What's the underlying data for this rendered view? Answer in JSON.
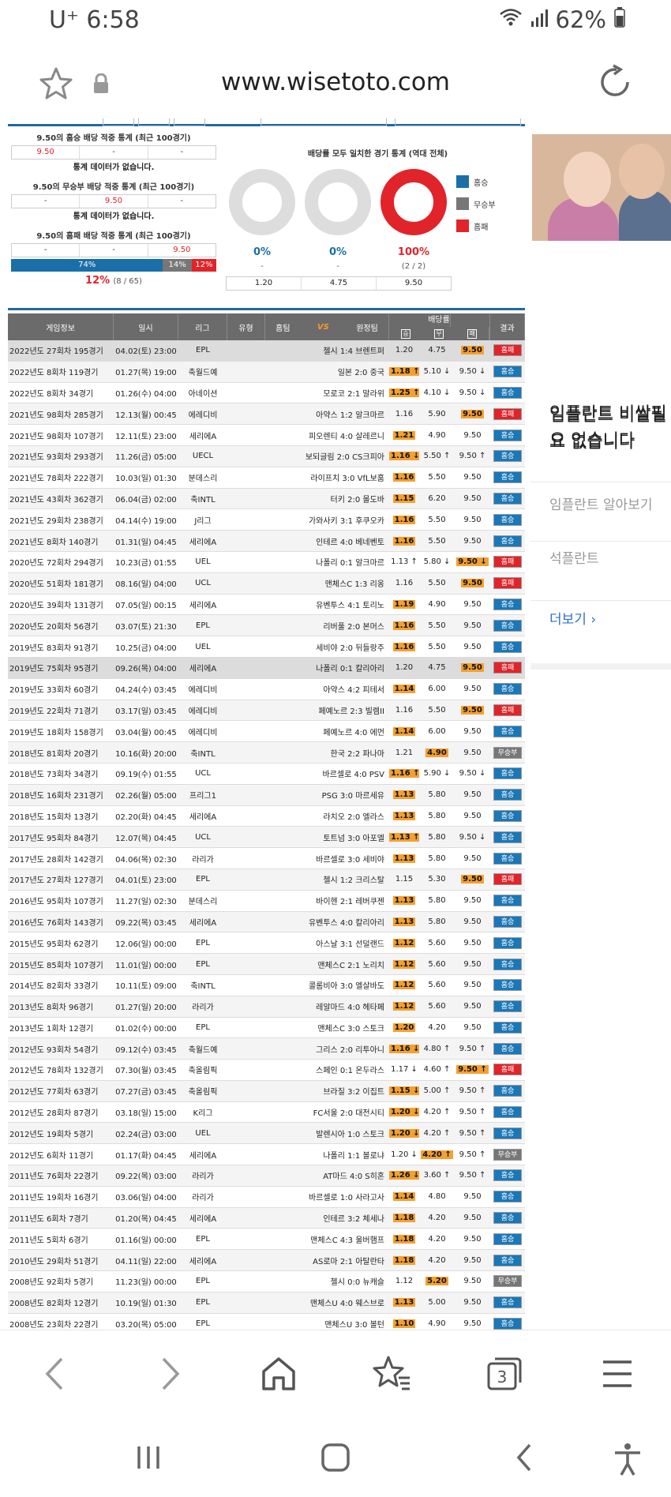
{
  "status_bar": {
    "carrier": "U⁺ 6:58",
    "battery": "62%"
  },
  "browser": {
    "url": "www.wisetoto.com",
    "tab_count": "3"
  },
  "stats": {
    "home_title": "9.50의 홈승 배당 적중 통계 (최근 100경기)",
    "home_vals": [
      "9.50",
      "-",
      "-"
    ],
    "no_data_1": "통계 데이터가 없습니다.",
    "draw_title": "9.50의 무승부 배당 적중 통계 (최근 100경기)",
    "draw_vals": [
      "-",
      "9.50",
      "-"
    ],
    "no_data_2": "통계 데이터가 없습니다.",
    "away_title": "9.50의 홈패 배당 적중 통계 (최근 100경기)",
    "away_vals": [
      "-",
      "-",
      "9.50"
    ],
    "bar": {
      "home": "74%",
      "draw": "14%",
      "away": "12%",
      "home_frac": 0.74,
      "draw_frac": 0.14,
      "away_frac": 0.12
    },
    "pct": "12%",
    "pct_detail": "(8 / 65)",
    "match_title": "배당률 모두 일치한 경기 통계 (역대 전체)",
    "donuts": [
      {
        "pct": "0%",
        "sub": "-",
        "fill": 0
      },
      {
        "pct": "0%",
        "sub": "-",
        "fill": 0
      },
      {
        "pct": "100%",
        "sub": "(2 / 2)",
        "fill": 1
      }
    ],
    "legend": [
      "홈승",
      "무승부",
      "홈패"
    ],
    "odds": [
      "1.20",
      "4.75",
      "9.50"
    ]
  },
  "colors": {
    "home": "#1a6fa8",
    "draw": "#777777",
    "away": "#e0242a",
    "highlight": "#f4a030",
    "header": "#6b6b6b"
  },
  "table": {
    "headers": {
      "info": "게임정보",
      "date": "일시",
      "league": "리그",
      "type": "유형",
      "home": "홈팀",
      "vs": "VS",
      "away": "원정팀",
      "odds": "배당률",
      "win": "승",
      "draw": "무",
      "lose": "패",
      "result": "결과"
    },
    "rows": [
      [
        "2022년도 27회차 195경기",
        "04.02(토) 23:00",
        "EPL",
        "",
        "첼시 1:4 브렌트퍼",
        "1.20",
        "4.75",
        "9.50",
        "L",
        "홈패",
        "hl"
      ],
      [
        "2022년도 8회차 119경기",
        "01.27(목) 19:00",
        "축월드예",
        "",
        "일본 2:0 중국",
        "1.18 ↑",
        "5.10 ↓",
        "9.50 ↓",
        "W",
        "홈승",
        ""
      ],
      [
        "2022년도 8회차 34경기",
        "01.26(수) 04:00",
        "아네이션",
        "",
        "모로코 2:1 말라위",
        "1.25 ↑",
        "4.10 ↓",
        "9.50 ↓",
        "W",
        "홈승",
        ""
      ],
      [
        "2021년도 98회차 285경기",
        "12.13(월) 00:45",
        "에레디비",
        "",
        "아약스 1:2 알크마르",
        "1.16",
        "5.90",
        "9.50",
        "L",
        "홈패",
        ""
      ],
      [
        "2021년도 98회차 107경기",
        "12.11(토) 23:00",
        "세리에A",
        "",
        "피오렌티 4:0 살레르니",
        "1.21",
        "4.90",
        "9.50",
        "W",
        "홈승",
        ""
      ],
      [
        "2021년도 93회차 293경기",
        "11.26(금) 05:00",
        "UECL",
        "",
        "보되글림 2:0 CS크피아",
        "1.16 ↓",
        "5.50 ↑",
        "9.50 ↑",
        "W",
        "홈승",
        ""
      ],
      [
        "2021년도 78회차 222경기",
        "10.03(일) 01:30",
        "분데스리",
        "",
        "라이프치 3:0 VfL보훔",
        "1.16",
        "5.50",
        "9.50",
        "W",
        "홈승",
        ""
      ],
      [
        "2021년도 43회차 362경기",
        "06.04(금) 02:00",
        "축INTL",
        "",
        "터키 2:0 몰도바",
        "1.15",
        "6.20",
        "9.50",
        "W",
        "홈승",
        ""
      ],
      [
        "2021년도 29회차 238경기",
        "04.14(수) 19:00",
        "J리그",
        "",
        "가와사키 3:1 후쿠오카",
        "1.16",
        "5.50",
        "9.50",
        "W",
        "홈승",
        ""
      ],
      [
        "2021년도 8회차 140경기",
        "01.31(일) 04:45",
        "세리에A",
        "",
        "인테르 4:0 베네벤토",
        "1.16",
        "5.50",
        "9.50",
        "W",
        "홈승",
        ""
      ],
      [
        "2020년도 72회차 294경기",
        "10.23(금) 01:55",
        "UEL",
        "",
        "나폴리 0:1 알크마르",
        "1.13 ↑",
        "5.80 ↓",
        "9.50 ↓",
        "L",
        "홈패",
        ""
      ],
      [
        "2020년도 51회차 181경기",
        "08.16(일) 04:00",
        "UCL",
        "",
        "맨체스C 1:3 리옹",
        "1.16",
        "5.50",
        "9.50",
        "L",
        "홈패",
        ""
      ],
      [
        "2020년도 39회차 131경기",
        "07.05(일) 00:15",
        "세리에A",
        "",
        "유벤투스 4:1 토리노",
        "1.19",
        "4.90",
        "9.50",
        "W",
        "홈승",
        ""
      ],
      [
        "2020년도 20회차 56경기",
        "03.07(토) 21:30",
        "EPL",
        "",
        "리버풀 2:0 본머스",
        "1.16",
        "5.50",
        "9.50",
        "W",
        "홈승",
        ""
      ],
      [
        "2019년도 83회차 91경기",
        "10.25(금) 04:00",
        "UEL",
        "",
        "세비야 2:0 뒤들랑주",
        "1.16",
        "5.50",
        "9.50",
        "W",
        "홈승",
        ""
      ],
      [
        "2019년도 75회차 95경기",
        "09.26(목) 04:00",
        "세리에A",
        "",
        "나폴리 0:1 칼리아리",
        "1.20",
        "4.75",
        "9.50",
        "L",
        "홈패",
        "hl"
      ],
      [
        "2019년도 33회차 60경기",
        "04.24(수) 03:45",
        "에레디비",
        "",
        "아약스 4:2 피테서",
        "1.14",
        "6.00",
        "9.50",
        "W",
        "홈승",
        ""
      ],
      [
        "2019년도 22회차 71경기",
        "03.17(일) 03:45",
        "에레디비",
        "",
        "페예노르 2:3 빌렘II",
        "1.16",
        "5.50",
        "9.50",
        "L",
        "홈패",
        ""
      ],
      [
        "2019년도 18회차 158경기",
        "03.04(월) 00:45",
        "에레디비",
        "",
        "페예노르 4:0 에먼",
        "1.14",
        "6.00",
        "9.50",
        "W",
        "홈승",
        ""
      ],
      [
        "2018년도 81회차 20경기",
        "10.16(화) 20:00",
        "축INTL",
        "",
        "한국 2:2 파나마",
        "1.21",
        "4.90",
        "9.50",
        "D",
        "무승부",
        ""
      ],
      [
        "2018년도 73회차 34경기",
        "09.19(수) 01:55",
        "UCL",
        "",
        "바르셀로 4:0 PSV",
        "1.16 ↑",
        "5.90 ↓",
        "9.50 ↓",
        "W",
        "홈승",
        ""
      ],
      [
        "2018년도 16회차 231경기",
        "02.26(월) 05:00",
        "프리그1",
        "",
        "PSG 3:0 마르세유",
        "1.13",
        "5.80",
        "9.50",
        "W",
        "홈승",
        ""
      ],
      [
        "2018년도 15회차 13경기",
        "02.20(화) 04:45",
        "세리에A",
        "",
        "라치오 2:0 엘라스",
        "1.13",
        "5.80",
        "9.50",
        "W",
        "홈승",
        ""
      ],
      [
        "2017년도 95회차 84경기",
        "12.07(목) 04:45",
        "UCL",
        "",
        "토트넘 3:0 아포엘",
        "1.13 ↑",
        "5.80",
        "9.50 ↓",
        "W",
        "홈승",
        ""
      ],
      [
        "2017년도 28회차 142경기",
        "04.06(목) 02:30",
        "라리가",
        "",
        "바르셀로 3:0 세비야",
        "1.13",
        "5.80",
        "9.50",
        "W",
        "홈승",
        ""
      ],
      [
        "2017년도 27회차 127경기",
        "04.01(토) 23:00",
        "EPL",
        "",
        "첼시 1:2 크리스탈",
        "1.15",
        "5.30",
        "9.50",
        "L",
        "홈패",
        ""
      ],
      [
        "2016년도 95회차 107경기",
        "11.27(일) 02:30",
        "분데스리",
        "",
        "바이헨 2:1 레버쿠젠",
        "1.13",
        "5.80",
        "9.50",
        "W",
        "홈승",
        ""
      ],
      [
        "2016년도 76회차 143경기",
        "09.22(목) 03:45",
        "세리에A",
        "",
        "유벤투스 4:0 칼리아리",
        "1.13",
        "5.80",
        "9.50",
        "W",
        "홈승",
        ""
      ],
      [
        "2015년도 95회차 62경기",
        "12.06(일) 00:00",
        "EPL",
        "",
        "아스날 3:1 선덜랜드",
        "1.12",
        "5.60",
        "9.50",
        "W",
        "홈승",
        ""
      ],
      [
        "2015년도 85회차 107경기",
        "11.01(일) 00:00",
        "EPL",
        "",
        "맨체스C 2:1 노리치",
        "1.12",
        "5.60",
        "9.50",
        "W",
        "홈승",
        ""
      ],
      [
        "2014년도 82회차 33경기",
        "10.11(토) 09:00",
        "축INTL",
        "",
        "콜롬비아 3:0 엘살바도",
        "1.12",
        "5.60",
        "9.50",
        "W",
        "홈승",
        ""
      ],
      [
        "2013년도 8회차 96경기",
        "01.27(일) 20:00",
        "라리가",
        "",
        "레알마드 4:0 헤타페",
        "1.12",
        "5.60",
        "9.50",
        "W",
        "홈승",
        ""
      ],
      [
        "2013년도 1회차 12경기",
        "01.02(수) 00:00",
        "EPL",
        "",
        "맨체스C 3:0 스토크",
        "1.20",
        "4.20",
        "9.50",
        "W",
        "홈승",
        ""
      ],
      [
        "2012년도 93회차 54경기",
        "09.12(수) 03:45",
        "축월드예",
        "",
        "그리스 2:0 리투아니",
        "1.16 ↓",
        "4.80 ↑",
        "9.50 ↑",
        "W",
        "홈승",
        ""
      ],
      [
        "2012년도 78회차 132경기",
        "07.30(월) 03:45",
        "축올림픽",
        "",
        "스페인 0:1 온두라스",
        "1.17 ↓",
        "4.60 ↑",
        "9.50 ↑",
        "L",
        "홈패",
        ""
      ],
      [
        "2012년도 77회차 63경기",
        "07.27(금) 03:45",
        "축올림픽",
        "",
        "브라질 3:2 이집트",
        "1.15 ↓",
        "5.00 ↑",
        "9.50 ↑",
        "W",
        "홈승",
        ""
      ],
      [
        "2012년도 28회차 87경기",
        "03.18(일) 15:00",
        "K리그",
        "",
        "FC서울 2:0 대전시티",
        "1.20 ↓",
        "4.20 ↑",
        "9.50 ↑",
        "W",
        "홈승",
        ""
      ],
      [
        "2012년도 19회차 5경기",
        "02.24(금) 03:00",
        "UEL",
        "",
        "발렌시아 1:0 스토크",
        "1.20 ↓",
        "4.20 ↑",
        "9.50 ↑",
        "W",
        "홈승",
        ""
      ],
      [
        "2012년도 6회차 11경기",
        "01.17(화) 04:45",
        "세리에A",
        "",
        "나폴리 1:1 볼로냐",
        "1.20 ↓",
        "4.20 ↑",
        "9.50 ↑",
        "D",
        "무승부",
        ""
      ],
      [
        "2011년도 76회차 22경기",
        "09.22(목) 03:00",
        "라리가",
        "",
        "AT마드 4:0 S히혼",
        "1.26 ↓",
        "3.60 ↑",
        "9.50 ↑",
        "W",
        "홈승",
        ""
      ],
      [
        "2011년도 19회차 16경기",
        "03.06(일) 04:00",
        "라리가",
        "",
        "바르셀로 1:0 사라고사",
        "1.14",
        "4.80",
        "9.50",
        "W",
        "홈승",
        ""
      ],
      [
        "2011년도 6회차 7경기",
        "01.20(목) 04:45",
        "세리에A",
        "",
        "인테르 3:2 체세나",
        "1.18",
        "4.20",
        "9.50",
        "W",
        "홈승",
        ""
      ],
      [
        "2011년도 5회차 6경기",
        "01.16(일) 00:00",
        "EPL",
        "",
        "맨체스C 4:3 울버햄프",
        "1.18",
        "4.20",
        "9.50",
        "W",
        "홈승",
        ""
      ],
      [
        "2010년도 29회차 51경기",
        "04.11(일) 22:00",
        "세리에A",
        "",
        "AS로마 2:1 아탈란타",
        "1.18",
        "4.20",
        "9.50",
        "W",
        "홈승",
        ""
      ],
      [
        "2008년도 92회차 5경기",
        "11.23(일) 00:00",
        "EPL",
        "",
        "첼시 0:0 뉴캐슬",
        "1.12",
        "5.20",
        "9.50",
        "D",
        "무승부",
        ""
      ],
      [
        "2008년도 82회차 12경기",
        "10.19(일) 01:30",
        "EPL",
        "",
        "맨체스U 4:0 웨스브로",
        "1.13",
        "5.00",
        "9.50",
        "W",
        "홈승",
        ""
      ],
      [
        "2008년도 23회차 22경기",
        "03.20(목) 05:00",
        "EPL",
        "",
        "맨체스U 3:0 볼턴",
        "1.10",
        "4.90",
        "9.50",
        "W",
        "홈승",
        ""
      ]
    ]
  },
  "ad": {
    "title": "임플란트 비쌀필요 없습니다",
    "link1": "임플란트 알아보기",
    "link2": "석플란트",
    "more": "더보기"
  }
}
